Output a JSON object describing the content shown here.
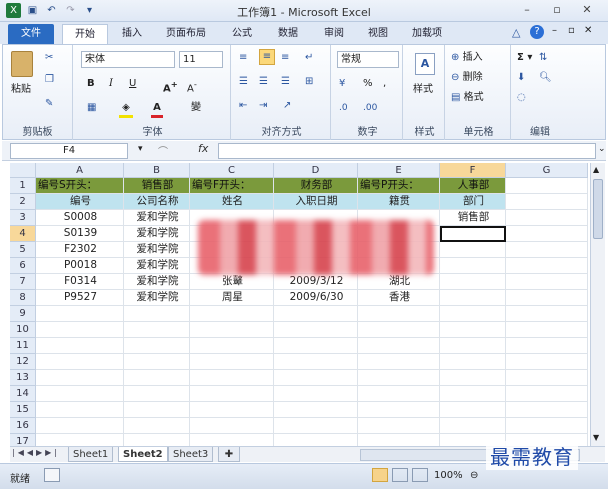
{
  "window": {
    "title": "工作簿1 - Microsoft Excel"
  },
  "ribbon": {
    "tabs": [
      "文件",
      "开始",
      "插入",
      "页面布局",
      "公式",
      "数据",
      "审阅",
      "视图",
      "加载项"
    ],
    "groups": {
      "clipboard": {
        "label": "剪贴板",
        "paste": "粘贴"
      },
      "font": {
        "label": "字体",
        "font_name": "宋体",
        "font_size": "11"
      },
      "alignment": {
        "label": "对齐方式"
      },
      "number": {
        "label": "数字",
        "format": "常规",
        "percent": "%"
      },
      "styles": {
        "label": "样式",
        "button": "样式"
      },
      "cells": {
        "label": "单元格",
        "insert": "插入",
        "delete": "删除",
        "format": "格式"
      },
      "editing": {
        "label": "编辑"
      }
    }
  },
  "formula_bar": {
    "name_box": "F4",
    "fx": "fx",
    "value": ""
  },
  "sheet": {
    "columns": [
      "A",
      "B",
      "C",
      "D",
      "E",
      "F",
      "G"
    ],
    "rows": [
      "1",
      "2",
      "3",
      "4",
      "5",
      "6",
      "7",
      "8",
      "9",
      "10",
      "11",
      "12",
      "13",
      "14",
      "15",
      "16",
      "17"
    ],
    "row1": [
      "编号S开头：",
      "销售部",
      "编号F开头：",
      "财务部",
      "编号P开头：",
      "人事部"
    ],
    "headers": [
      "编号",
      "公司名称",
      "姓名",
      "入职日期",
      "籍贯",
      "部门"
    ],
    "data": [
      [
        "S0008",
        "爱和学院",
        "",
        "",
        "",
        "销售部"
      ],
      [
        "S0139",
        "爱和学院",
        "",
        "",
        "",
        ""
      ],
      [
        "F2302",
        "爱和学院",
        "",
        "",
        "",
        ""
      ],
      [
        "P0018",
        "爱和学院",
        "",
        "",
        "",
        ""
      ],
      [
        "F0314",
        "爱和学院",
        "张鼙",
        "2009/3/12",
        "湖北",
        ""
      ],
      [
        "P9527",
        "爱和学院",
        "周星",
        "2009/6/30",
        "香港",
        ""
      ]
    ]
  },
  "sheet_tabs": [
    "Sheet1",
    "Sheet2",
    "Sheet3"
  ],
  "status": {
    "ready": "就绪",
    "zoom": "100%"
  },
  "watermark": "最需教育"
}
